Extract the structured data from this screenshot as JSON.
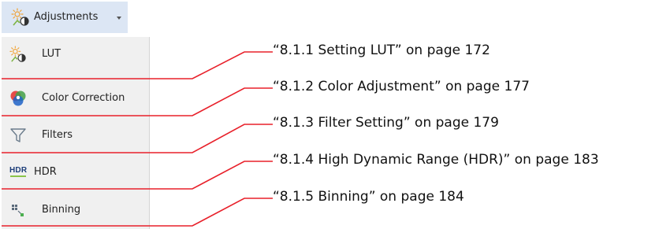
{
  "toolbar": {
    "adjustments_label": "Adjustments"
  },
  "menu": {
    "items": [
      {
        "label": "LUT",
        "icon": "lut-icon"
      },
      {
        "label": "Color Correction",
        "icon": "color-wheel-icon"
      },
      {
        "label": "Filters",
        "icon": "funnel-icon"
      },
      {
        "label": "HDR",
        "icon": "hdr-icon",
        "icon_text": "HDR"
      },
      {
        "label": "Binning",
        "icon": "binning-icon"
      }
    ]
  },
  "references": [
    "“8.1.1 Setting LUT” on page 172",
    "“8.1.2 Color Adjustment” on page 177",
    "“8.1.3 Filter Setting” on page 179",
    "“8.1.4 High Dynamic Range (HDR)” on page 183",
    "“8.1.5 Binning” on page 184"
  ],
  "colors": {
    "leader_line": "#e8202a",
    "toolbar_highlight": "#dce6f4",
    "menu_background": "#f0f0f0",
    "hdr_accent": "#8bc34a"
  }
}
